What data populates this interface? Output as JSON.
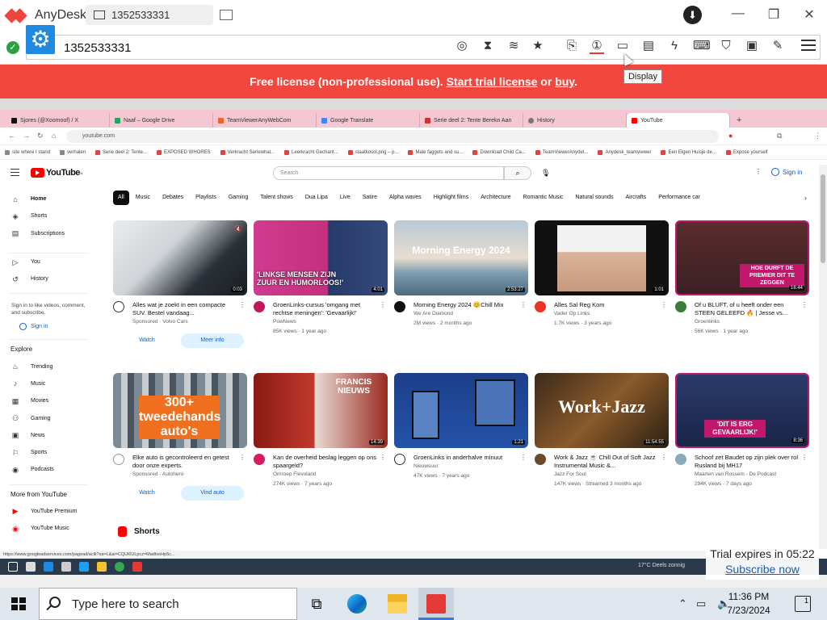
{
  "anydesk": {
    "app_name": "AnyDesk",
    "tab_label": "1352533331",
    "address": "1352533331",
    "tooltip": "Display",
    "license_text": "Free license (non-professional use). ",
    "license_link": "Start trial license",
    "license_or": " or ",
    "license_buy": "buy",
    "license_end": ".",
    "trial_text": "Trial expires in 05:22",
    "subscribe": "Subscribe now"
  },
  "chrome": {
    "tabs": [
      "Sjores (@Xoomoof) / X",
      "Naaf – Google Drive",
      "TeamViewerAnyWebCom",
      "Google Translate",
      "Serie deel 2: Tente Berekn Aan",
      "History",
      "YouTube"
    ],
    "url": "youtube.com",
    "bookmarks": [
      "site where I stand",
      "verhalen",
      "Serie deel 2: Tente...",
      "EXPOSED WHORES",
      "Verkracht Seriewhal...",
      "Leerkracht Gechant...",
      "staatkosol.png – p...",
      "Male faggots and su...",
      "Download Child Ca...",
      "TeamViewerAnydet...",
      "Anydesk_teamviewer",
      "Een Eigen Huisje de...",
      "Expose yourself"
    ],
    "status_url": "https://www.googleadservices.com/pagead/aclk?sa=L&ai=CQUi6ULpcz=MadtvoHp5c..."
  },
  "youtube": {
    "logo": "YouTube",
    "logo_region": "NL",
    "search_placeholder": "Search",
    "sign_in": "Sign in",
    "sidebar": {
      "main": [
        "Home",
        "Shorts",
        "Subscriptions"
      ],
      "you": [
        "You",
        "History"
      ],
      "note": "Sign in to like videos, comment, and subscribe.",
      "sign_in": "Sign in",
      "explore_title": "Explore",
      "explore": [
        "Trending",
        "Music",
        "Movies",
        "Gaming",
        "News",
        "Sports",
        "Podcasts"
      ],
      "more_title": "More from YouTube",
      "more": [
        "YouTube Premium",
        "YouTube Music"
      ]
    },
    "chips": [
      "All",
      "Music",
      "Debates",
      "Playlists",
      "Gaming",
      "Talent shows",
      "Dua Lipa",
      "Live",
      "Satire",
      "Alpha waves",
      "Highlight films",
      "Architecture",
      "Romantic Music",
      "Natural sounds",
      "Aircrafts",
      "Performance car"
    ],
    "videos": [
      {
        "title": "Alles wat je zoekt in een compacte SUV. Bestel vandaag...",
        "line2": "Sponsored · Volvo Cars",
        "line3": "",
        "dur": "0:03",
        "btn1": "Watch",
        "btn2": "Meer info",
        "thumb_text": ""
      },
      {
        "title": "GroenLinks-cursus 'omgang met rechtse meningen': 'Gevaarlijk!'",
        "line2": "PowNews",
        "line3": "85K views · 1 year ago",
        "dur": "4:01",
        "thumb_text": "'LINKSE MENSEN ZIJN ZUUR EN HUMORLOOS!'"
      },
      {
        "title": "Morning Energy 2024 😊Chill Mix",
        "line2": "We Are Diamond",
        "line3": "2M views · 2 months ago",
        "dur": "2:53:27",
        "thumb_text": "Morning Energy 2024"
      },
      {
        "title": "Alles Sal Reg Kom",
        "line2": "Vader Op Links",
        "line3": "1.7K views · 3 years ago",
        "dur": "1:01",
        "thumb_text": ""
      },
      {
        "title": "Of u BLUFT, of u heeft onder een STEEN GELEEFD 🔥 | Jesse vs...",
        "line2": "Groenlinks",
        "line3": "56K views · 1 year ago",
        "dur": "16:44",
        "thumb_text": "HOE DURFT DE PREMIER DIT TE ZEGGEN"
      },
      {
        "title": "Elke auto is gecontroleerd en getest door onze experts.",
        "line2": "Sponsored · Autohero",
        "line3": "",
        "dur": "",
        "btn1": "Watch",
        "btn2": "Vind auto",
        "thumb_text": "300+ tweedehands auto's"
      },
      {
        "title": "Kan de overheid beslag leggen op ons spaargeld?",
        "line2": "Omroep Flevoland",
        "line3": "274K views · 7 years ago",
        "dur": "14:39",
        "thumb_text": "FRANCIS NIEUWS"
      },
      {
        "title": "GroenLinks in anderhalve minuut",
        "line2": "Nieuwsuur",
        "line3": "47K views · 7 years ago",
        "dur": "1:21",
        "thumb_text": ""
      },
      {
        "title": "Work & Jazz ☕ Chill Out of Soft Jazz Instrumental Music &...",
        "line2": "Jazz For Soul",
        "line3": "147K views · Streamed 3 months ago",
        "dur": "11:54:55",
        "thumb_text": "Work+Jazz"
      },
      {
        "title": "Schoof zet Baudet op zijn plek over rol Rusland bij MH17",
        "line2": "Maarten van Rossem - De Podcast",
        "line3": "294K views · 7 days ago",
        "dur": "8:36",
        "thumb_text": "'DIT IS ERG GEVAARLIJK!'"
      }
    ],
    "shorts_title": "Shorts"
  },
  "remote_taskbar": {
    "weather": "17°C  Deels zonnig"
  },
  "taskbar": {
    "search_placeholder": "Type here to search",
    "time": "11:36 PM",
    "date": "7/23/2024",
    "notif_count": "1"
  }
}
